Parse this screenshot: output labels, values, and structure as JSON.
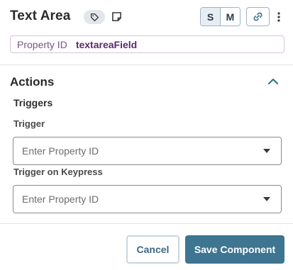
{
  "header": {
    "title": "Text Area",
    "tag_icon": "tag-icon",
    "note_icon": "note-icon",
    "size_options": [
      "S",
      "M"
    ],
    "selected_size": "S",
    "link_icon": "link-icon",
    "more_icon": "more-vertical-icon"
  },
  "property_id": {
    "label": "Property ID",
    "value": "textareaField"
  },
  "actions": {
    "title": "Actions",
    "collapse_icon": "chevron-up-icon",
    "triggers_title": "Triggers",
    "trigger": {
      "label": "Trigger",
      "placeholder": "Enter Property ID"
    },
    "trigger_on_keypress": {
      "label": "Trigger on Keypress",
      "placeholder": "Enter Property ID"
    }
  },
  "footer": {
    "cancel_label": "Cancel",
    "save_label": "Save Component"
  },
  "colors": {
    "primary": "#3e7590",
    "property_accent": "#5b2a6a",
    "chevron": "#2f7a8a"
  }
}
